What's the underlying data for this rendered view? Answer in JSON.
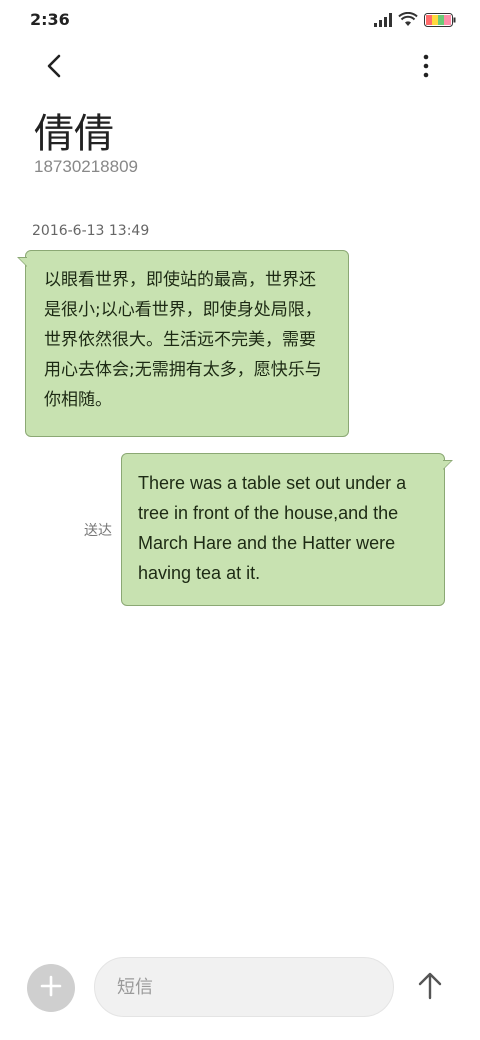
{
  "status_bar": {
    "time": "2:36",
    "icons": [
      "signal-icon",
      "wifi-icon",
      "battery-icon"
    ],
    "battery_colors": [
      "#ff6b6b",
      "#ffd93d",
      "#6bcB77",
      "#4d96ff"
    ]
  },
  "header": {
    "back_icon": "chevron-left-icon",
    "more_icon": "more-vertical-icon",
    "contact_name": "倩倩",
    "contact_number": "18730218809"
  },
  "conversation": {
    "timestamp": "2016-6-13 13:49",
    "messages": [
      {
        "direction": "incoming",
        "text": "以眼看世界，即使站的最高，世界还是很小;以心看世界，即使身处局限，世界依然很大。生活远不完美，需要用心去体会;无需拥有太多，愿快乐与你相随。"
      },
      {
        "direction": "outgoing",
        "text": "There was a table set out under a tree in front of the house,and the March Hare and the Hatter were having tea at it.",
        "status": "送达"
      }
    ]
  },
  "composer": {
    "add_icon": "plus-icon",
    "placeholder": "短信",
    "value": "",
    "send_icon": "arrow-up-icon"
  },
  "colors": {
    "bubble_fill": "#c8e2b1",
    "bubble_border": "#8ba874",
    "add_button": "#cfcfcf"
  }
}
